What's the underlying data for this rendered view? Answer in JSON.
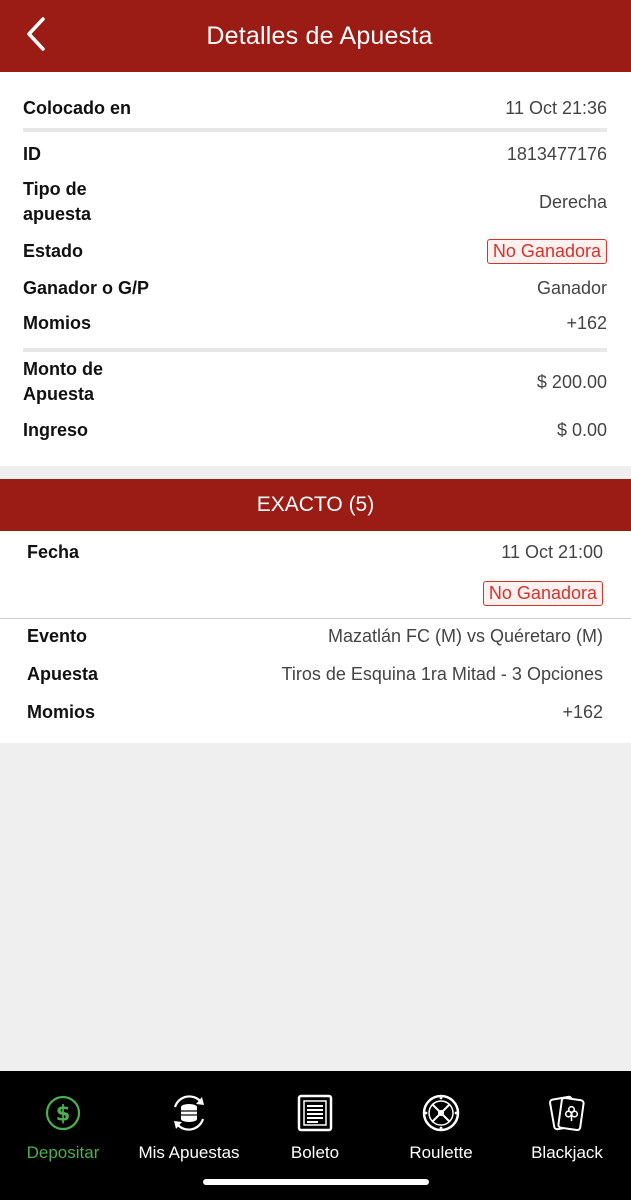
{
  "header": {
    "title": "Detalles de Apuesta"
  },
  "bet": {
    "placed_label": "Colocado en",
    "placed_value": "11 Oct 21:36",
    "id_label": "ID",
    "id_value": "1813477176",
    "type_label_1": "Tipo de",
    "type_label_2": "apuesta",
    "type_value": "Derecha",
    "status_label": "Estado",
    "status_value": "No Ganadora",
    "winner_label": "Ganador o G/P",
    "winner_value": "Ganador",
    "odds_label": "Momios",
    "odds_value": "+162",
    "amount_label_1": "Monto de",
    "amount_label_2": "Apuesta",
    "amount_value": "$ 200.00",
    "income_label": "Ingreso",
    "income_value": "$ 0.00"
  },
  "selection": {
    "header": "EXACTO (5)",
    "date_label": "Fecha",
    "date_value": "11 Oct 21:00",
    "status_value": "No Ganadora",
    "event_label": "Evento",
    "event_value": "Mazatlán FC (M) vs Quéretaro (M)",
    "bet_label": "Apuesta",
    "bet_value": "Tiros de Esquina 1ra Mitad - 3 Opciones",
    "odds_label": "Momios",
    "odds_value": "+162"
  },
  "nav": {
    "items": [
      {
        "label": "Depositar",
        "icon": "dollar-icon",
        "active": true
      },
      {
        "label": "Mis Apuestas",
        "icon": "coins-icon"
      },
      {
        "label": "Boleto",
        "icon": "ticket-icon"
      },
      {
        "label": "Roulette",
        "icon": "roulette-icon"
      },
      {
        "label": "Blackjack",
        "icon": "cards-icon"
      }
    ]
  },
  "colors": {
    "brand": "#9b1c14",
    "lose": "#d0342c",
    "active": "#4caf50"
  }
}
